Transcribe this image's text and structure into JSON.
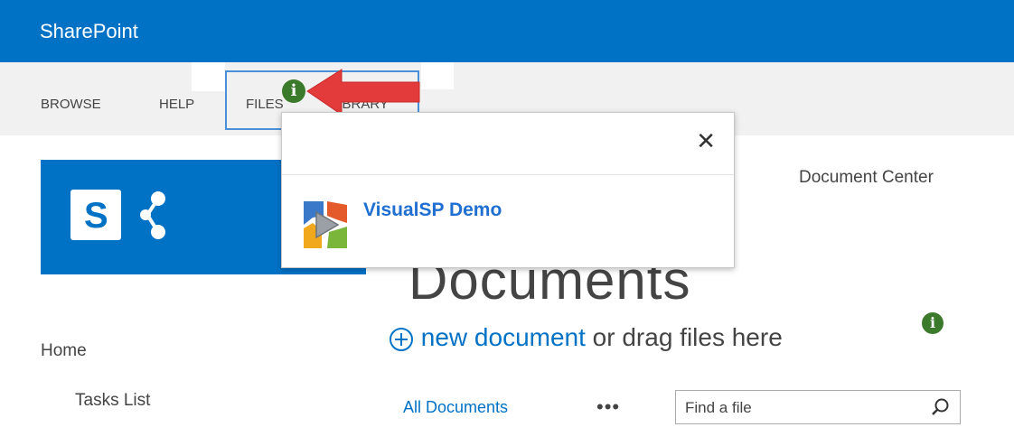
{
  "suite_bar": {
    "brand": "SharePoint",
    "color": "#0072c6"
  },
  "ribbon": {
    "tabs": [
      {
        "label": "BROWSE"
      },
      {
        "label": "HELP"
      },
      {
        "label": "FILES"
      },
      {
        "label": "LIBRARY",
        "partially_hidden": true
      }
    ]
  },
  "logo": {
    "letter": "S",
    "color": "#0072c6"
  },
  "top_nav": {
    "link": "Document Center"
  },
  "page": {
    "title": "Documents"
  },
  "callout": {
    "new_document": "new document",
    "rest": " or drag files here"
  },
  "left_nav": {
    "items": [
      {
        "label": "Home"
      },
      {
        "label": "Tasks List"
      }
    ]
  },
  "views": {
    "current": "All Documents",
    "more": "•••"
  },
  "search": {
    "placeholder": "Find a file"
  },
  "popup": {
    "close": "✕",
    "item_label": "VisualSP Demo"
  },
  "info_icon": {
    "glyph": "i",
    "color": "#3c7a2b"
  },
  "accent_colors": {
    "link": "#0072c6",
    "arrow": "#e33b3b"
  }
}
